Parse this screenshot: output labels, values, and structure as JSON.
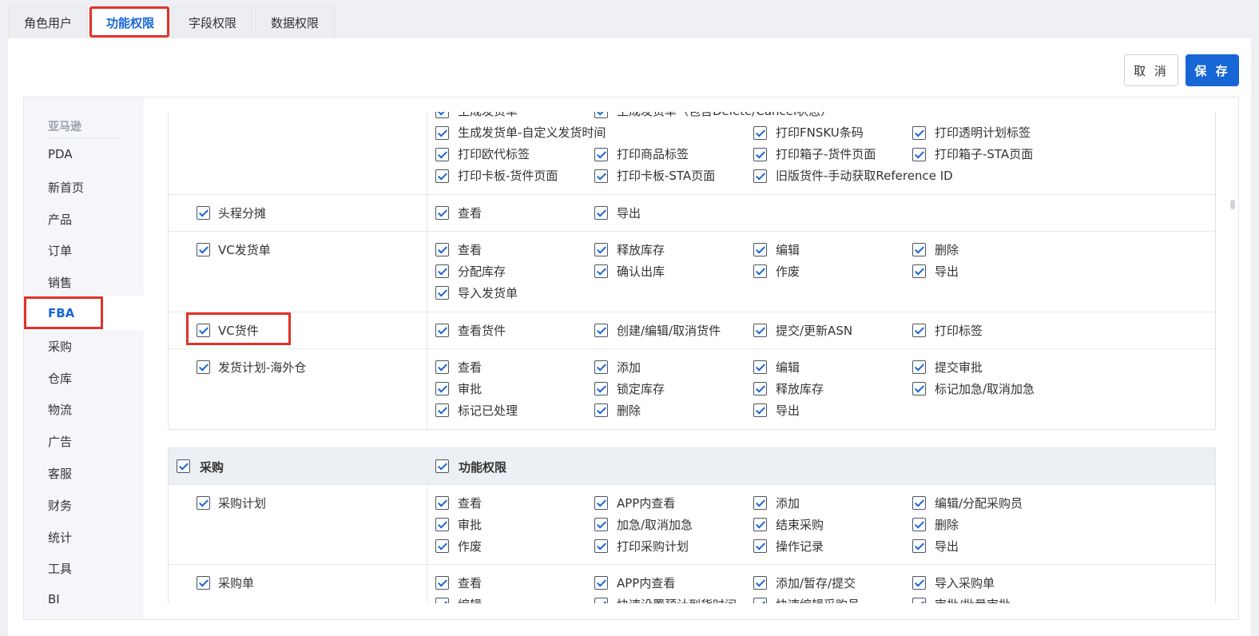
{
  "tabs": [
    {
      "label": "角色用户"
    },
    {
      "label": "功能权限",
      "active": true
    },
    {
      "label": "字段权限"
    },
    {
      "label": "数据权限"
    }
  ],
  "actions": {
    "cancel": "取 消",
    "save": "保 存"
  },
  "nav": {
    "group": "亚马逊",
    "items": [
      "PDA",
      "新首页",
      "产品",
      "订单",
      "销售",
      "FBA",
      "采购",
      "仓库",
      "物流",
      "广告",
      "客服",
      "财务",
      "统计",
      "工具",
      "BI"
    ],
    "active": "FBA"
  },
  "fba_rows": [
    {
      "module": "",
      "perms": [
        "生成发货单",
        "生成发货单（包含Delete/Cancel状态）",
        "生成发货单-自定义发货时间",
        "打印FNSKU条码",
        "打印透明计划标签",
        "打印欧代标签",
        "打印商品标签",
        "打印箱子-货件页面",
        "打印箱子-STA页面",
        "打印卡板-货件页面",
        "打印卡板-STA页面",
        "旧版货件-手动获取Reference ID"
      ]
    },
    {
      "module": "头程分摊",
      "perms": [
        "查看",
        "导出"
      ]
    },
    {
      "module": "VC发货单",
      "perms": [
        "查看",
        "释放库存",
        "编辑",
        "删除",
        "分配库存",
        "确认出库",
        "作废",
        "导出",
        "导入发货单"
      ]
    },
    {
      "module": "VC货件",
      "perms": [
        "查看货件",
        "创建/编辑/取消货件",
        "提交/更新ASN",
        "打印标签"
      ]
    },
    {
      "module": "发货计划-海外仓",
      "perms": [
        "查看",
        "添加",
        "编辑",
        "提交审批",
        "审批",
        "锁定库存",
        "释放库存",
        "标记加急/取消加急",
        "标记已处理",
        "删除",
        "导出"
      ]
    }
  ],
  "purchase": {
    "header": {
      "module": "采购",
      "perms": "功能权限"
    },
    "rows": [
      {
        "module": "采购计划",
        "perms": [
          "查看",
          "APP内查看",
          "添加",
          "编辑/分配采购员",
          "审批",
          "加急/取消加急",
          "结束采购",
          "删除",
          "作废",
          "打印采购计划",
          "操作记录",
          "导出"
        ]
      },
      {
        "module": "采购单",
        "perms": [
          "查看",
          "APP内查看",
          "添加/暂存/提交",
          "导入采购单",
          "编辑",
          "快速设置预计到货时间",
          "快速编辑采购员",
          "审批/批量审批"
        ]
      }
    ]
  },
  "colors": {
    "accent": "#1766d6",
    "highlight": "#e23228"
  }
}
